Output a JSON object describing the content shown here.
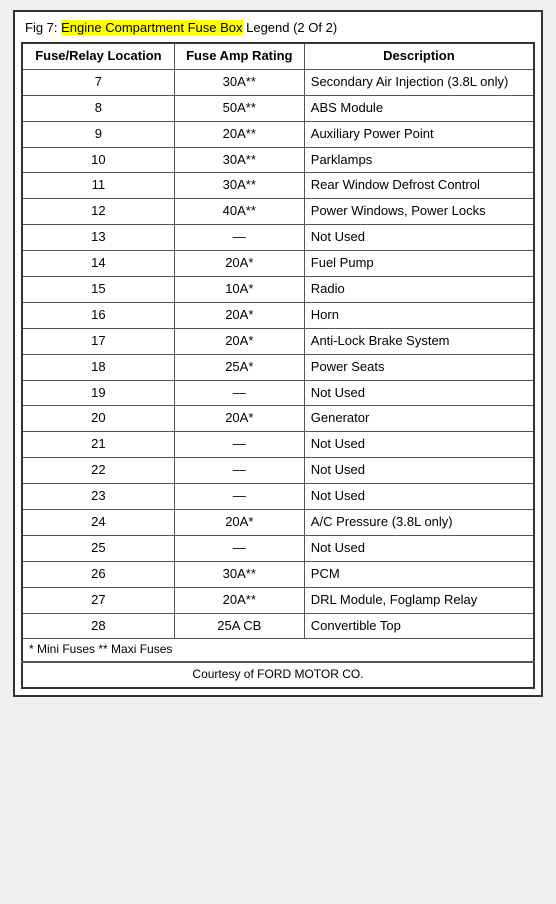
{
  "title": {
    "prefix": "Fig 7: ",
    "highlight": "Engine Compartment Fuse Box",
    "suffix": " Legend (2 Of 2)"
  },
  "headers": {
    "col1": "Fuse/Relay Location",
    "col2": "Fuse Amp Rating",
    "col3": "Description"
  },
  "rows": [
    {
      "location": "7",
      "amp": "30A**",
      "desc": "Secondary Air Injection (3.8L only)"
    },
    {
      "location": "8",
      "amp": "50A**",
      "desc": "ABS Module"
    },
    {
      "location": "9",
      "amp": "20A**",
      "desc": "Auxiliary Power Point"
    },
    {
      "location": "10",
      "amp": "30A**",
      "desc": "Parklamps"
    },
    {
      "location": "11",
      "amp": "30A**",
      "desc": "Rear Window Defrost Control"
    },
    {
      "location": "12",
      "amp": "40A**",
      "desc": "Power Windows, Power Locks"
    },
    {
      "location": "13",
      "amp": "—",
      "desc": "Not Used"
    },
    {
      "location": "14",
      "amp": "20A*",
      "desc": "Fuel Pump"
    },
    {
      "location": "15",
      "amp": "10A*",
      "desc": "Radio"
    },
    {
      "location": "16",
      "amp": "20A*",
      "desc": "Horn"
    },
    {
      "location": "17",
      "amp": "20A*",
      "desc": "Anti-Lock Brake System"
    },
    {
      "location": "18",
      "amp": "25A*",
      "desc": "Power Seats"
    },
    {
      "location": "19",
      "amp": "—",
      "desc": "Not Used"
    },
    {
      "location": "20",
      "amp": "20A*",
      "desc": "Generator"
    },
    {
      "location": "21",
      "amp": "—",
      "desc": "Not Used"
    },
    {
      "location": "22",
      "amp": "—",
      "desc": "Not Used"
    },
    {
      "location": "23",
      "amp": "—",
      "desc": "Not Used"
    },
    {
      "location": "24",
      "amp": "20A*",
      "desc": "A/C Pressure (3.8L only)"
    },
    {
      "location": "25",
      "amp": "—",
      "desc": "Not Used"
    },
    {
      "location": "26",
      "amp": "30A**",
      "desc": "PCM"
    },
    {
      "location": "27",
      "amp": "20A**",
      "desc": "DRL Module, Foglamp Relay"
    },
    {
      "location": "28",
      "amp": "25A CB",
      "desc": "Convertible Top"
    }
  ],
  "footnote": "* Mini Fuses ** Maxi Fuses",
  "courtesy": "Courtesy of FORD MOTOR CO."
}
